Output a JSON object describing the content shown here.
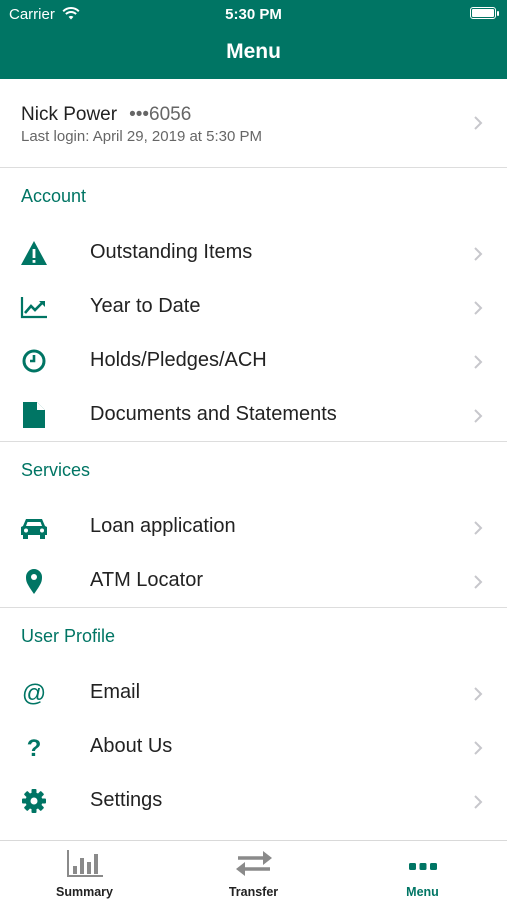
{
  "status_bar": {
    "carrier": "Carrier",
    "time": "5:30 PM"
  },
  "header": {
    "title": "Menu"
  },
  "user": {
    "name": "Nick Power",
    "masked_account": "•••6056",
    "last_login": "Last login: April 29, 2019 at 5:30 PM"
  },
  "sections": {
    "account": {
      "title": "Account",
      "items": [
        {
          "label": "Outstanding Items",
          "icon": "warning-icon"
        },
        {
          "label": "Year to Date",
          "icon": "trend-chart-icon"
        },
        {
          "label": "Holds/Pledges/ACH",
          "icon": "clock-icon"
        },
        {
          "label": "Documents and Statements",
          "icon": "document-icon"
        }
      ]
    },
    "services": {
      "title": "Services",
      "items": [
        {
          "label": "Loan application",
          "icon": "car-icon"
        },
        {
          "label": "ATM Locator",
          "icon": "location-pin-icon"
        }
      ]
    },
    "profile": {
      "title": "User Profile",
      "items": [
        {
          "label": "Email",
          "icon": "at-sign-icon"
        },
        {
          "label": "About Us",
          "icon": "question-icon"
        },
        {
          "label": "Settings",
          "icon": "gear-icon"
        }
      ]
    }
  },
  "tabs": [
    {
      "label": "Summary",
      "icon": "bar-chart-icon"
    },
    {
      "label": "Transfer",
      "icon": "transfer-arrows-icon"
    },
    {
      "label": "Menu",
      "icon": "more-dots-icon"
    }
  ],
  "colors": {
    "brand": "#007564",
    "text": "#222222",
    "muted": "#666666",
    "chevron": "#c7c7cc",
    "tab_inactive": "#8a8a8a"
  }
}
